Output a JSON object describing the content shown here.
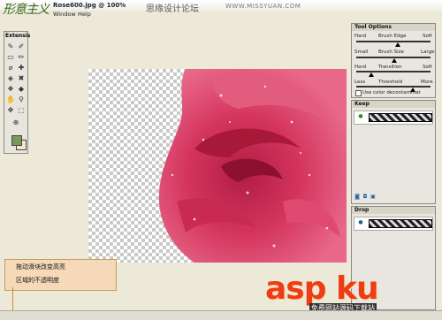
{
  "window": {
    "doc_title": "Rose600.jpg @ 100%",
    "site_name": "思缘设计论坛",
    "site_url": "WWW.MISSYUAN.COM",
    "logo_text": "形意主义"
  },
  "menu": [
    "Window",
    "Help"
  ],
  "tools_panel": {
    "title": "Extensis"
  },
  "tool_options": {
    "title": "Tool Options",
    "brush_edge": {
      "left": "Hard",
      "center": "Brush Edge",
      "right": "Soft",
      "value_pct": 55
    },
    "brush_size": {
      "left": "Small",
      "center": "Brush Size",
      "right": "Large",
      "value_pct": 50
    },
    "transition": {
      "left": "Hard",
      "center": "Transition",
      "right": "Soft",
      "value_pct": 20
    },
    "threshold": {
      "left": "Less",
      "center": "Threshold",
      "right": "More",
      "value_pct": 75
    },
    "decontaminate_label": "Use color decontaminat"
  },
  "keep_panel": {
    "title": "Keep"
  },
  "drop_panel": {
    "title": "Drop"
  },
  "callout": {
    "line1": "拖动滑块改变高亮",
    "line2": "区域的不透明度"
  },
  "watermark": {
    "main": "asp ku",
    "sub": "免费网站源码下载站"
  },
  "colors": {
    "rose": "#d4345c",
    "accent": "#ee3c14",
    "callout": "#f6d9b8"
  },
  "icons": [
    "brush-icon",
    "eraser-icon",
    "eyedropper-icon",
    "hand-icon",
    "zoom-icon",
    "fill-icon"
  ]
}
